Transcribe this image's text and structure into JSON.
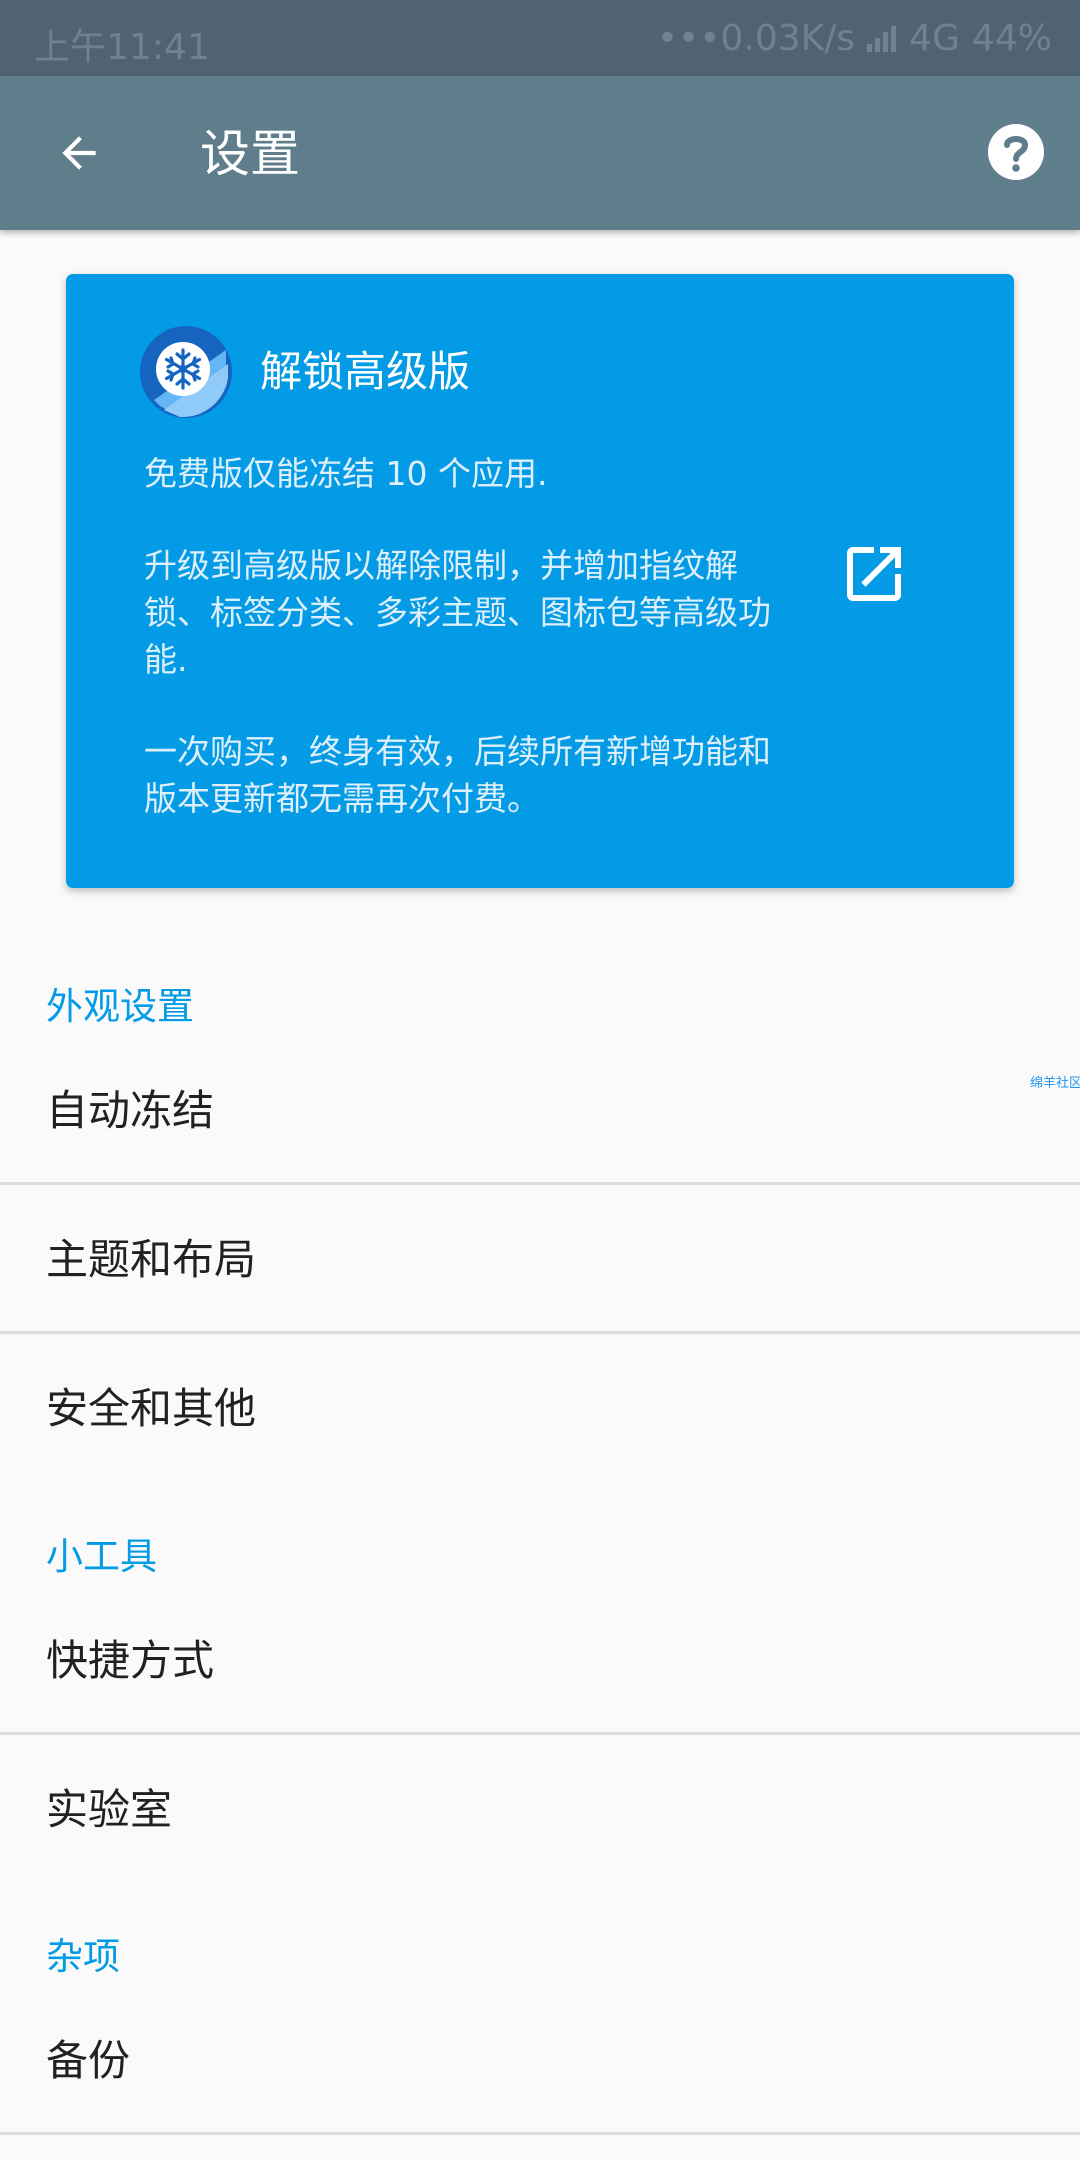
{
  "status_bar": {
    "time": "上午11:41",
    "network_speed": "•••0.03K/s",
    "network_type": "4G",
    "battery": "44%"
  },
  "app_bar": {
    "title": "设置",
    "back_icon": "arrow-back-icon",
    "help_icon": "help-circle-icon"
  },
  "premium_card": {
    "title": "解锁高级版",
    "line_1": "免费版仅能冻结 10 个应用.",
    "line_2": "升级到高级版以解除限制，并增加指纹解",
    "line_3": "锁、标签分类、多彩主题、图标包等高级功",
    "line_4": "能.",
    "line_5": "一次购买，终身有效，后续所有新增功能和",
    "line_6": "版本更新都无需再次付费。",
    "logo_icon": "snowflake-logo-icon",
    "open_icon": "open-in-new-icon",
    "color": "#039be5"
  },
  "watermark": "绵羊社区",
  "sections": [
    {
      "header": "外观设置",
      "items": [
        "自动冻结",
        "主题和布局",
        "安全和其他"
      ]
    },
    {
      "header": "小工具",
      "items": [
        "快捷方式",
        "实验室"
      ]
    },
    {
      "header": "杂项",
      "items": [
        "备份"
      ]
    }
  ],
  "colors": {
    "app_bar": "#607d8b",
    "status_bar": "#4f6470",
    "accent": "#039be5",
    "background": "#fafafa"
  }
}
